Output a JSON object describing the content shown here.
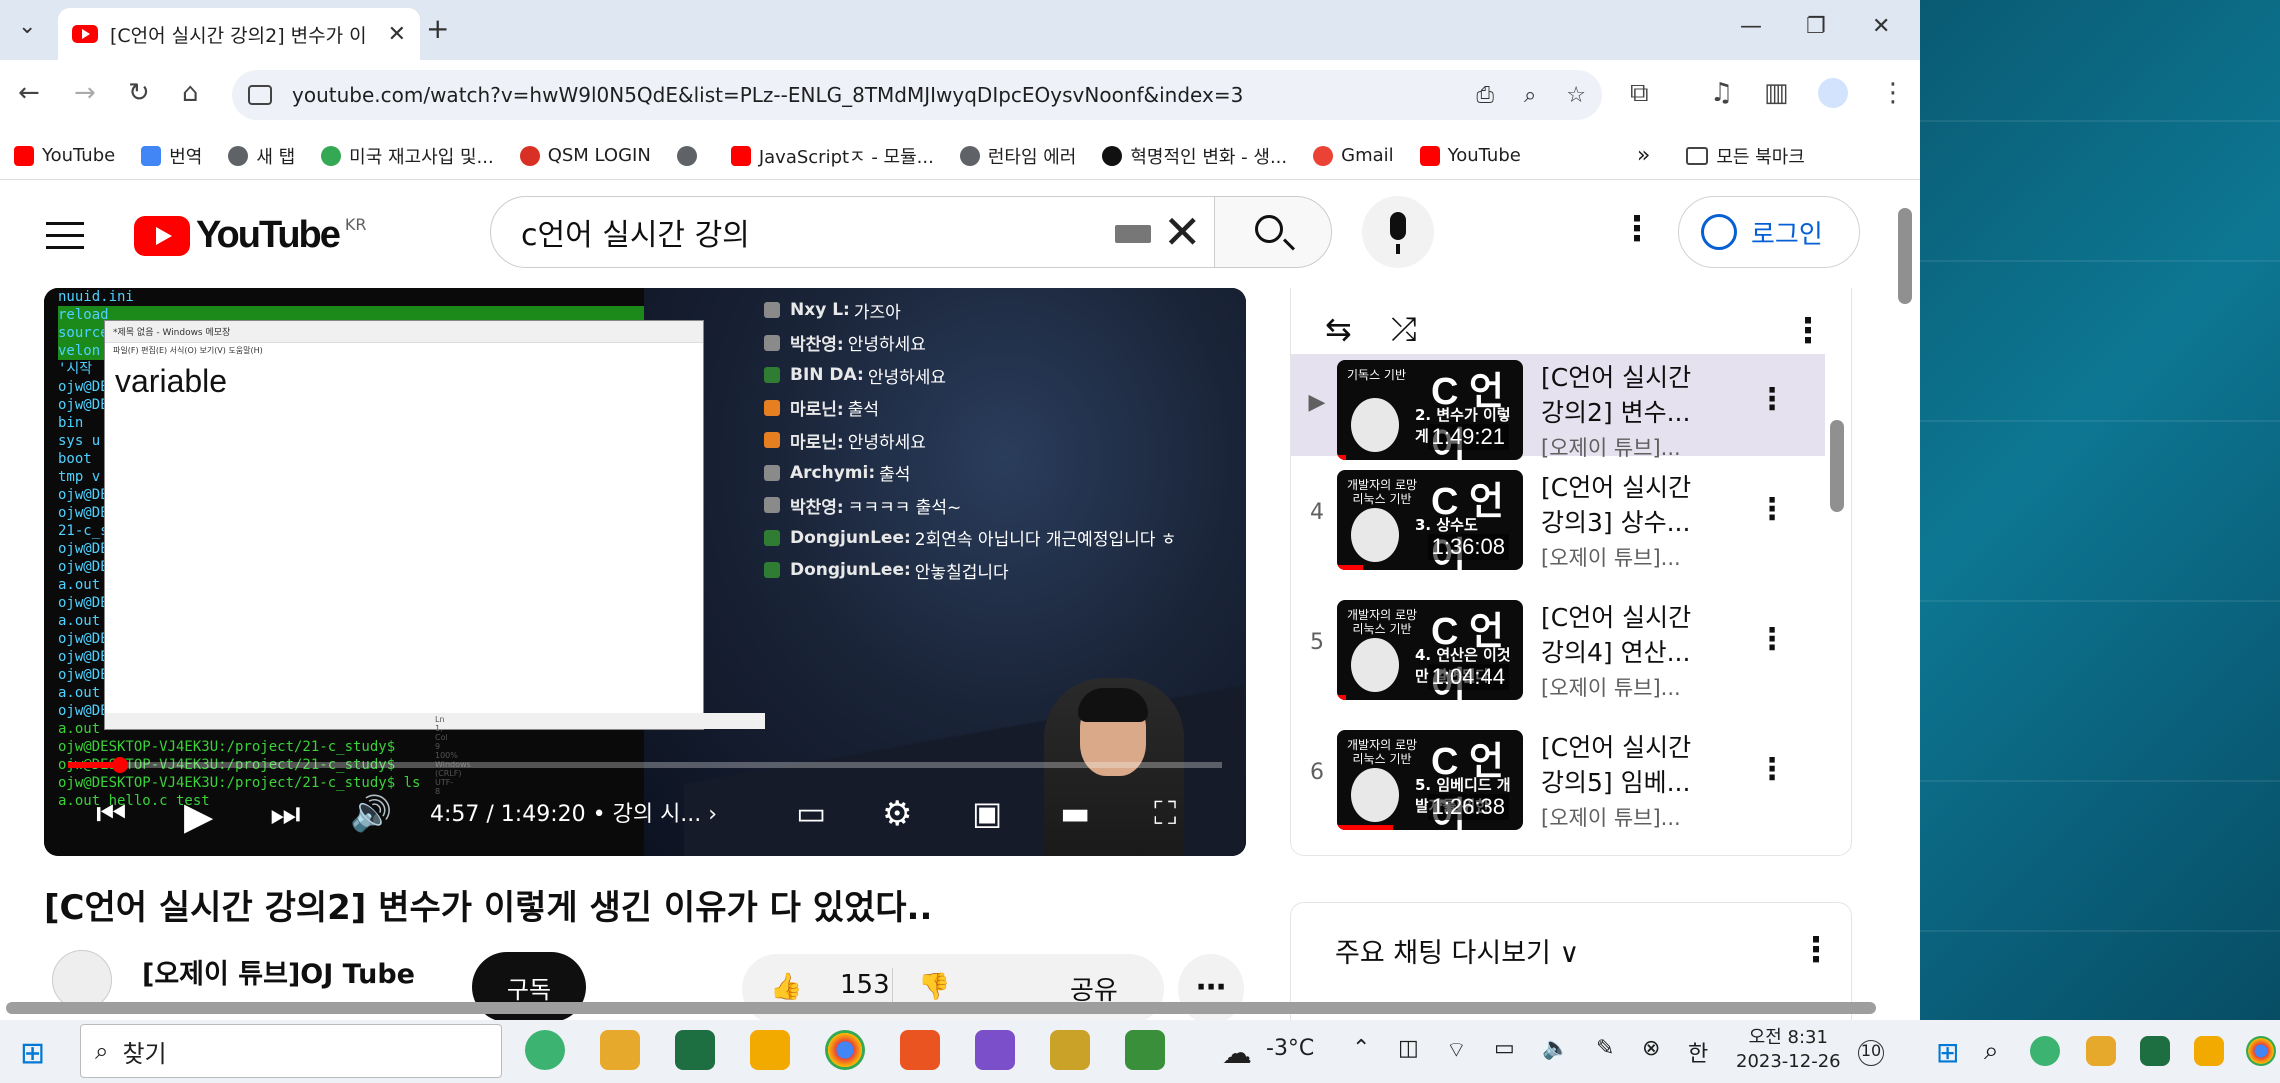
{
  "tab": {
    "title": "[C언어 실시간 강의2] 변수가 이",
    "close": "✕",
    "new_tab": "+"
  },
  "window": {
    "minimize": "—",
    "restore": "❐",
    "close": "✕"
  },
  "address": {
    "url": "youtube.com/watch?v=hwW9l0N5QdE&list=PLz--ENLG_8TMdMJIwyqDIpcEOysvNoonf&index=3"
  },
  "bookmarks": {
    "items": [
      {
        "label": "YouTube",
        "color": "#ff0000"
      },
      {
        "label": "번역",
        "color": "#4285f4"
      },
      {
        "label": "새 탭",
        "color": "#5f6368"
      },
      {
        "label": "미국 재고사입 및...",
        "color": "#34a853"
      },
      {
        "label": "QSM LOGIN",
        "color": "#d93025"
      },
      {
        "label": "",
        "color": "#5f6368"
      },
      {
        "label": "JavaScriptㅈ - 모듈...",
        "color": "#ff0000"
      },
      {
        "label": "런타임 에러",
        "color": "#5f6368"
      },
      {
        "label": "혁명적인 변화 - 생...",
        "color": "#111111"
      },
      {
        "label": "Gmail",
        "color": "#ea4335"
      },
      {
        "label": "YouTube",
        "color": "#ff0000"
      }
    ],
    "overflow": "»",
    "all": "모든 북마크"
  },
  "yt": {
    "logo": "YouTube",
    "region": "KR",
    "search_query": "c언어 실시간 강의",
    "login": "로그인"
  },
  "video": {
    "time": "4:57 / 1:49:20",
    "chapter": "• 강의 시...",
    "progress": 0.045,
    "notepad_title": "*제목 없음 - Windows 메모장",
    "notepad_menu": "파일(F)  편집(E)  서식(O)  보기(V)  도움말(H)",
    "notepad_text": "variable",
    "notepad_status": "Ln 1, Col 9       100%   Windows (CRLF)     UTF-8",
    "terminal_lines": [
      "nuuid.ini",
      "reload",
      "source",
      "velon",
      "'시작",
      "ojw@DE",
      "ojw@DE",
      "bin",
      "sys  u",
      "boot",
      "tmp  v",
      "ojw@DE",
      "ojw@DE",
      "21-c_s",
      "ojw@DE",
      "ojw@DE",
      "a.out",
      "ojw@DE",
      "a.out",
      "ojw@DE",
      "ojw@DE",
      "ojw@DE",
      "a.out",
      "ojw@DE",
      "a.out",
      "ojw@DESKTOP-VJ4EK3U:/project/21-c_study$",
      "ojw@DESKTOP-VJ4EK3U:/project/21-c_study$",
      "ojw@DESKTOP-VJ4EK3U:/project/21-c_study$ ls",
      "a.out  hello.c  test"
    ],
    "chat": [
      {
        "name": "Nxy L:",
        "msg": "가즈아",
        "color": "#8a8a8a"
      },
      {
        "name": "박찬영:",
        "msg": "안녕하세요",
        "color": "#8a8a8a"
      },
      {
        "name": "BIN DA:",
        "msg": "안녕하세요",
        "color": "#2e7d32"
      },
      {
        "name": "마로닌:",
        "msg": "출석",
        "color": "#e67e22"
      },
      {
        "name": "마로닌:",
        "msg": "안녕하세요",
        "color": "#e67e22"
      },
      {
        "name": "Archymi:",
        "msg": "출석",
        "color": "#8a8a8a"
      },
      {
        "name": "박찬영:",
        "msg": "ㅋㅋㅋㅋ 출석~",
        "color": "#8a8a8a"
      },
      {
        "name": "DongjunLee:",
        "msg": "2회연속 아닙니다 개근예정입니다 ㅎ",
        "color": "#2e7d32"
      },
      {
        "name": "DongjunLee:",
        "msg": "안놓칠겁니다",
        "color": "#2e7d32"
      }
    ]
  },
  "title": "[C언어 실시간 강의2] 변수가 이렇게 생긴 이유가 다 있었다..",
  "channel": {
    "name": "[오제이 튜브]OJ Tube",
    "subscribe": "구독"
  },
  "actions": {
    "likes": "153",
    "share": "공유"
  },
  "playlist": {
    "items": [
      {
        "index": "▶",
        "title": "[C언어 실시간 강의2] 변수...",
        "channel": "[오제이 튜브]...",
        "duration": "1:49:21",
        "thumb_head": "기독스 기반",
        "thumb_sub": "2. 변수가 이렇게",
        "selected": true,
        "watched": 0.05
      },
      {
        "index": "4",
        "title": "[C언어 실시간 강의3] 상수...",
        "channel": "[오제이 튜브]...",
        "duration": "1:36:08",
        "thumb_head": "개발자의 로망\n리눅스 기반",
        "thumb_sub": "3. 상수도",
        "selected": false,
        "watched": 0.14
      },
      {
        "index": "5",
        "title": "[C언어 실시간 강의4] 연산...",
        "channel": "[오제이 튜브]...",
        "duration": "1:04:44",
        "thumb_head": "개발자의 로망\n리눅스 기반",
        "thumb_sub": "4. 연산은 이것만 알면된다",
        "selected": false,
        "watched": 0.05
      },
      {
        "index": "6",
        "title": "[C언어 실시간 강의5] 임베...",
        "channel": "[오제이 튜브]...",
        "duration": "1:26:38",
        "thumb_head": "개발자의 로망\n리눅스 기반",
        "thumb_sub": "5. 임베디드 개발자를 위한",
        "selected": false,
        "watched": 0.3
      }
    ],
    "thumb_logo": "C 언어"
  },
  "chat_replay": {
    "label": "주요 채팅 다시보기 ∨"
  },
  "taskbar": {
    "search": "찾기",
    "weather": "-3°C",
    "ime": "한",
    "time": "오전 8:31",
    "date": "2023-12-26",
    "notif": "10"
  }
}
